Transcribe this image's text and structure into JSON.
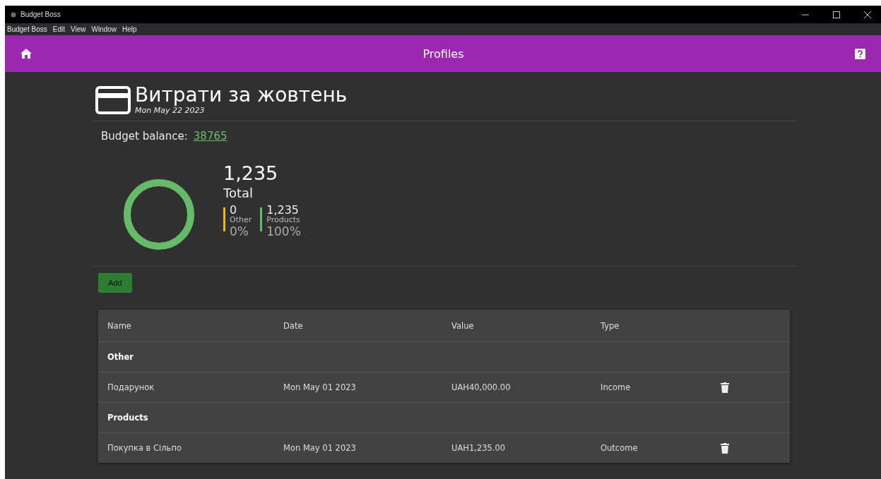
{
  "window": {
    "title": "Budget Boss"
  },
  "menu": [
    "Budget Boss",
    "Edit",
    "View",
    "Window",
    "Help"
  ],
  "header": {
    "title": "Profiles"
  },
  "budget": {
    "title": "Витрати за жовтень",
    "date": "Mon May 22 2023",
    "balance_label": "Budget balance:",
    "balance": "38765"
  },
  "summary": {
    "total": "1,235",
    "total_label": "Total",
    "legend": [
      {
        "value": "0",
        "label": "Other",
        "percent": "0%",
        "color": "#f2b90f"
      },
      {
        "value": "1,235",
        "label": "Products",
        "percent": "100%",
        "color": "#66bb6a"
      }
    ]
  },
  "add_button": "Add",
  "table": {
    "columns": [
      "Name",
      "Date",
      "Value",
      "Type"
    ],
    "rows": [
      {
        "kind": "group",
        "name": "Other"
      },
      {
        "kind": "entry",
        "name": "Подарунок",
        "date": "Mon May 01 2023",
        "value": "UAH40,000.00",
        "type": "Income"
      },
      {
        "kind": "group",
        "name": "Products"
      },
      {
        "kind": "entry",
        "name": "Покупка в Сільпо",
        "date": "Mon May 01 2023",
        "value": "UAH1,235.00",
        "type": "Outcome"
      }
    ]
  }
}
